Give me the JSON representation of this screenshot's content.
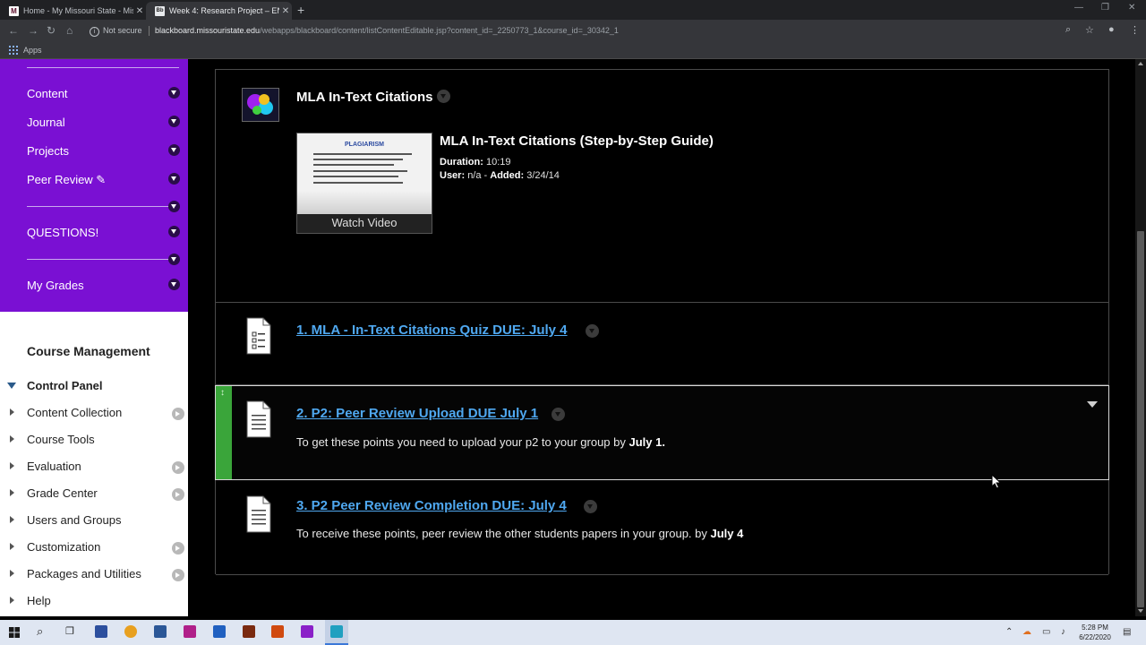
{
  "browser": {
    "tabs": [
      {
        "title": "Home - My Missouri State - Miss",
        "favicon_letter": "M"
      },
      {
        "title": "Week 4: Research Project – ENG",
        "favicon_letter": "Bb"
      }
    ],
    "security_label": "Not secure",
    "url_host": "blackboard.missouristate.edu",
    "url_path": "/webapps/blackboard/content/listContentEditable.jsp?content_id=_2250773_1&course_id=_30342_1",
    "bookmarks_apps": "Apps"
  },
  "course_menu": {
    "items": [
      {
        "label": "Content"
      },
      {
        "label": "Journal"
      },
      {
        "label": "Projects"
      },
      {
        "label": "Peer Review ✎"
      },
      {
        "label": "QUESTIONS!"
      },
      {
        "label": "My Grades"
      }
    ]
  },
  "course_management": {
    "title": "Course Management",
    "control_panel": "Control Panel",
    "items": [
      {
        "label": "Content Collection",
        "has_go": true
      },
      {
        "label": "Course Tools",
        "has_go": false
      },
      {
        "label": "Evaluation",
        "has_go": true
      },
      {
        "label": "Grade Center",
        "has_go": true
      },
      {
        "label": "Users and Groups",
        "has_go": false
      },
      {
        "label": "Customization",
        "has_go": true
      },
      {
        "label": "Packages and Utilities",
        "has_go": true
      },
      {
        "label": "Help",
        "has_go": false
      }
    ]
  },
  "content": {
    "mla": {
      "title": "MLA In-Text Citations",
      "video": {
        "thumb_title": "PLAGIARISM",
        "watch_label": "Watch Video",
        "title": "MLA In-Text Citations (Step-by-Step Guide)",
        "duration_label": "Duration:",
        "duration": "10:19",
        "user_label": "User:",
        "user": "n/a",
        "added_label": "Added:",
        "added": "3/24/14"
      }
    },
    "quiz": {
      "title": "1. MLA - In-Text Citations Quiz DUE: July 4"
    },
    "upload": {
      "title": "2. P2: Peer Review Upload DUE July 1",
      "desc": "To get these points you need to upload your p2 to your group by ",
      "desc_bold": "July 1."
    },
    "peer": {
      "title": "3. P2 Peer Review Completion DUE: July 4",
      "desc": "To receive these points, peer review the other students papers in your group. by ",
      "desc_bold": "July 4"
    }
  },
  "taskbar": {
    "time": "5:28 PM",
    "date": "6/22/2020"
  },
  "colors": {
    "course_menu_bg": "#7a10d3",
    "link_blue": "#4fa8f0",
    "drag_green": "#3aa53a"
  }
}
